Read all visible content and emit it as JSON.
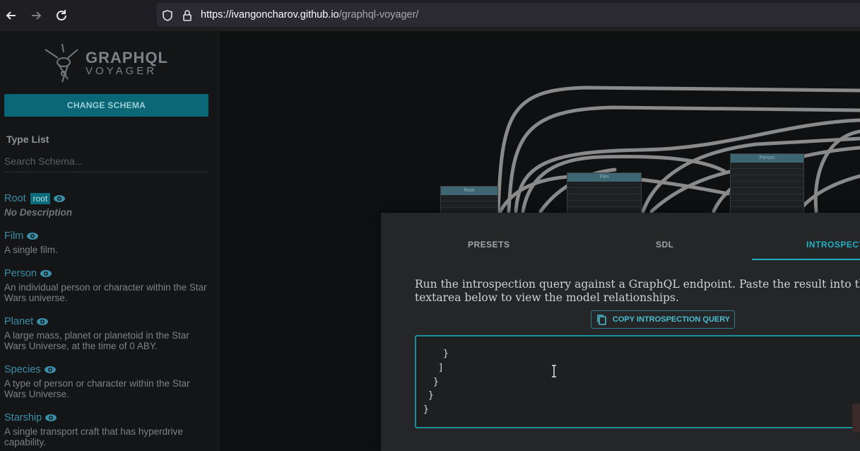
{
  "browser": {
    "url_host": "https://ivangoncharov.github.io",
    "url_path": "/graphql-voyager/",
    "back_icon": "arrow-left-icon",
    "forward_icon": "arrow-right-icon",
    "reload_icon": "reload-icon"
  },
  "sidebar": {
    "logo_title": "GRAPHQL",
    "logo_subtitle": "VOYAGER",
    "change_schema_label": "CHANGE SCHEMA",
    "type_list_title": "Type List",
    "search_placeholder": "Search Schema...",
    "types": [
      {
        "name": "Root",
        "badge": "root",
        "description": "No Description",
        "no_desc": true
      },
      {
        "name": "Film",
        "description": "A single film."
      },
      {
        "name": "Person",
        "description": "An individual person or character within the Star Wars universe."
      },
      {
        "name": "Planet",
        "description": "A large mass, planet or planetoid in the Star Wars Universe, at the time of 0 ABY."
      },
      {
        "name": "Species",
        "description": "A type of person or character within the Star Wars Universe."
      },
      {
        "name": "Starship",
        "description": "A single transport craft that has hyperdrive capability."
      }
    ]
  },
  "graph": {
    "nodes": [
      {
        "title": "Root"
      },
      {
        "title": "Film"
      },
      {
        "title": "Person"
      }
    ]
  },
  "panel": {
    "tabs": [
      "PRESETS",
      "SDL",
      "INTROSPECTION"
    ],
    "active_tab": "INTROSPECTION",
    "instructions": "Run the introspection query against a GraphQL endpoint. Paste the result into the textarea below to view the model relationships.",
    "copy_button_label": "COPY INTROSPECTION QUERY",
    "textarea_lines": [
      "}",
      "]",
      "}",
      "}",
      "}"
    ]
  },
  "colors": {
    "accent": "#23b0c4",
    "button_bg": "#0b6675",
    "link": "#3a8fa6"
  }
}
